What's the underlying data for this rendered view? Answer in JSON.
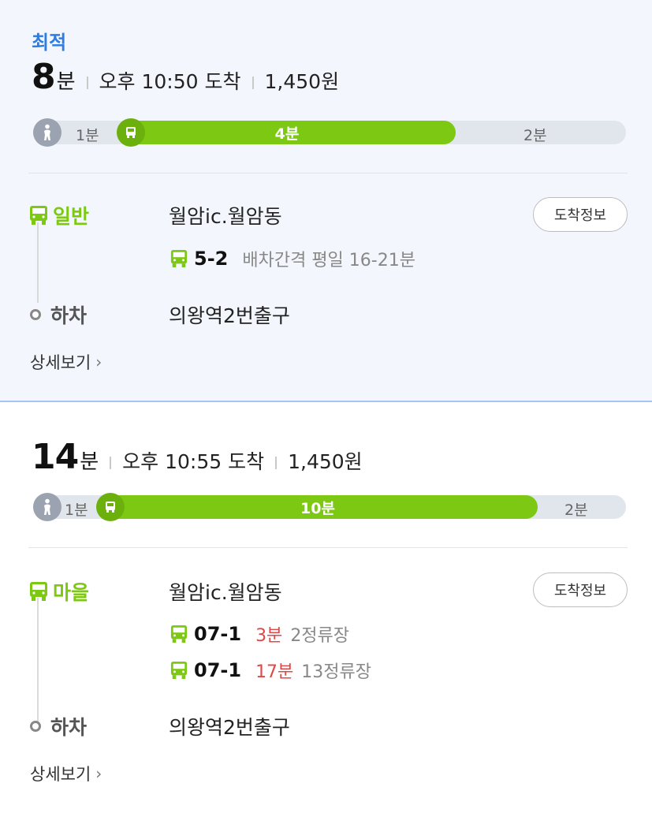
{
  "route1": {
    "best_tag": "최적",
    "duration_num": "8",
    "duration_unit": "분",
    "arrival": "오후 10:50 도착",
    "fare": "1,450원",
    "bar": {
      "walk_label": "1분",
      "ride_label": "4분",
      "end_label": "2분"
    },
    "leg": {
      "type_label": "일반",
      "board_stop": "월암ic.월암동",
      "arrival_button": "도착정보",
      "buses": [
        {
          "number": "5-2",
          "info": "배차간격 평일 16-21분"
        }
      ]
    },
    "alight_label": "하차",
    "alight_stop": "의왕역2번출구",
    "detail_link": "상세보기"
  },
  "route2": {
    "duration_num": "14",
    "duration_unit": "분",
    "arrival": "오후 10:55 도착",
    "fare": "1,450원",
    "bar": {
      "walk_label": "1분",
      "ride_label": "10분",
      "end_label": "2분"
    },
    "leg": {
      "type_label": "마을",
      "board_stop": "월암ic.월암동",
      "arrival_button": "도착정보",
      "buses": [
        {
          "number": "07-1",
          "eta": "3분",
          "stops": "2정류장"
        },
        {
          "number": "07-1",
          "eta": "17분",
          "stops": "13정류장"
        }
      ]
    },
    "alight_label": "하차",
    "alight_stop": "의왕역2번출구",
    "detail_link": "상세보기"
  },
  "colors": {
    "bus_green": "#7cc813",
    "best_blue": "#2f7de1",
    "eta_red": "#e04848"
  },
  "icons": [
    "walk-icon",
    "bus-icon",
    "chevron-right-icon"
  ]
}
